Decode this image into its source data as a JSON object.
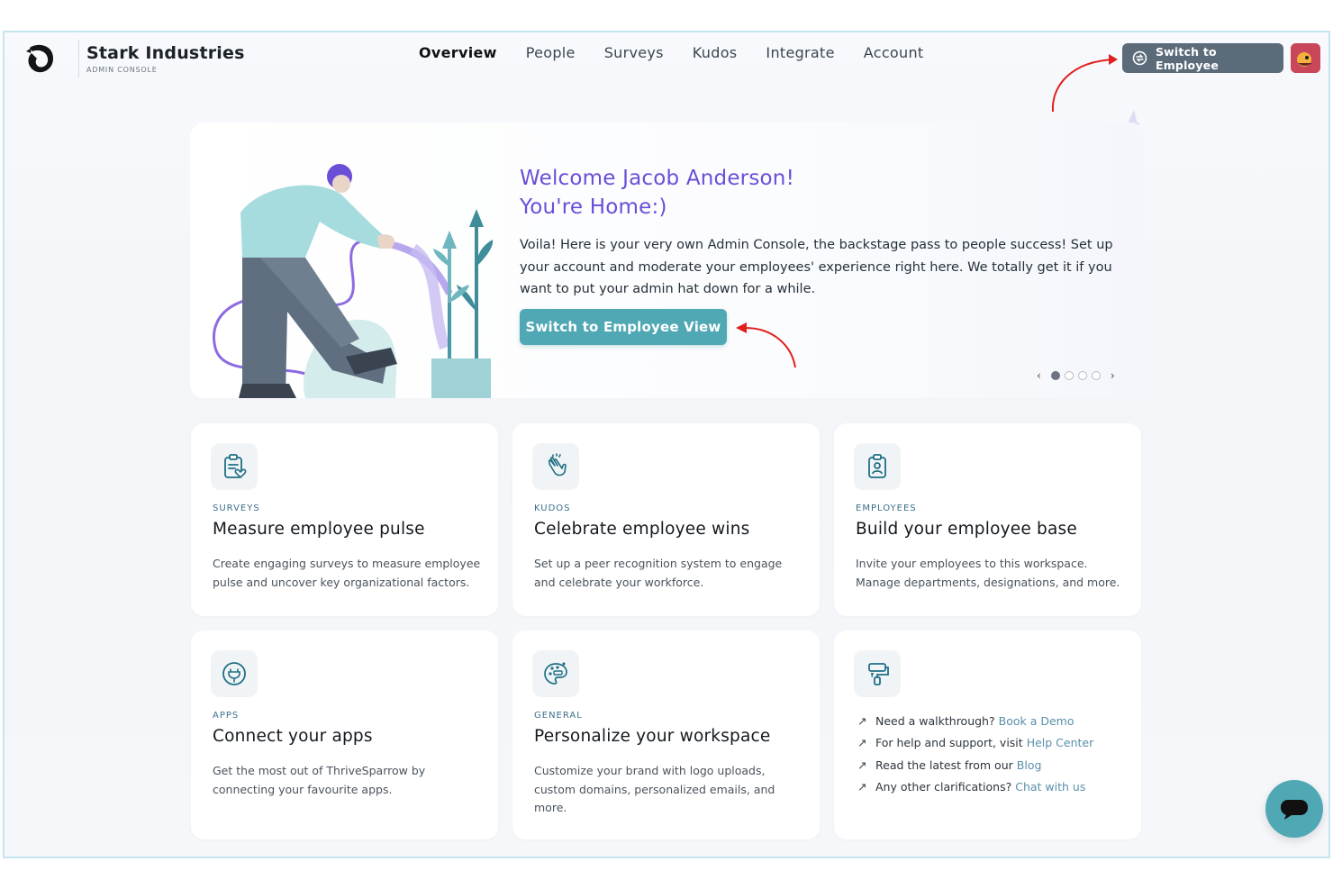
{
  "header": {
    "brand_name": "Stark Industries",
    "brand_sub": "ADMIN CONSOLE",
    "nav": [
      "Overview",
      "People",
      "Surveys",
      "Kudos",
      "Integrate",
      "Account"
    ],
    "active_nav": "Overview",
    "switch_label": "Switch to Employee"
  },
  "hero": {
    "title_line1": "Welcome Jacob Anderson!",
    "title_line2": "You're Home:)",
    "body": "Voila! Here is your very own Admin Console, the backstage pass to people success! Set up your account and moderate your employees' experience right here. We totally get it if you want to put your admin hat down for a while.",
    "button": "Switch to Employee View",
    "carousel_prev": "‹",
    "carousel_next": "›",
    "slides": 4,
    "current_slide": 1
  },
  "cards": [
    {
      "tag": "SURVEYS",
      "title": "Measure employee pulse",
      "desc": "Create engaging surveys to measure employee pulse and uncover key organizational factors.",
      "icon": "clipboard-heart-icon"
    },
    {
      "tag": "KUDOS",
      "title": "Celebrate employee wins",
      "desc": "Set up a peer recognition system to engage and celebrate your workforce.",
      "icon": "clapping-hands-icon"
    },
    {
      "tag": "EMPLOYEES",
      "title": "Build your employee base",
      "desc": "Invite your employees to this workspace. Manage departments, designations, and more.",
      "icon": "id-badge-icon"
    },
    {
      "tag": "APPS",
      "title": "Connect your apps",
      "desc": "Get the most out of ThriveSparrow by connecting your favourite apps.",
      "icon": "plug-icon"
    },
    {
      "tag": "GENERAL",
      "title": "Personalize your workspace",
      "desc": "Customize your brand with logo uploads, custom domains, personalized emails, and more.",
      "icon": "palette-icon"
    }
  ],
  "help": {
    "icon": "paint-roller-icon",
    "rows": [
      {
        "text": "Need a walkthrough?",
        "link": "Book a Demo"
      },
      {
        "text": "For help and support, visit",
        "link": "Help Center"
      },
      {
        "text": "Read the latest from our",
        "link": "Blog"
      },
      {
        "text": "Any other clarifications?",
        "link": "Chat with us"
      }
    ]
  },
  "colors": {
    "accent": "#4fa8b4",
    "title_purple": "#6a4ed8",
    "switch_bg": "#5b6b7a",
    "annotation_red": "#e0201c"
  }
}
